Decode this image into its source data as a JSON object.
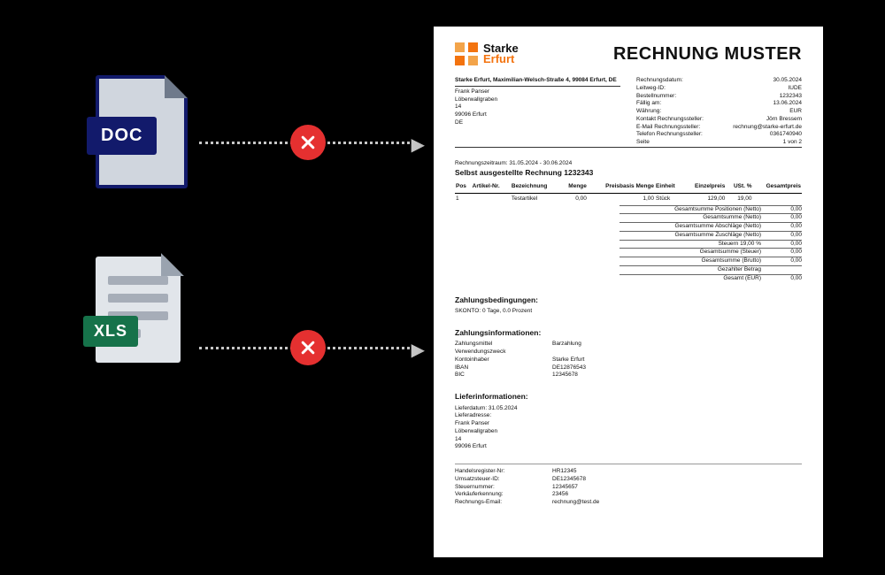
{
  "file_icons": {
    "doc_label": "DOC",
    "xls_label": "XLS"
  },
  "icons": {
    "reject": "reject-icon",
    "arrow": "arrow-right-icon"
  },
  "invoice": {
    "brand_l1": "Starke",
    "brand_l2": "Erfurt",
    "title": "RECHNUNG MUSTER",
    "sender_line": "Starke Erfurt, Maximilian-Welsch-Straße 4, 99084 Erfurt, DE",
    "recipient": {
      "name": "Frank Panser",
      "street": "Löberwallgraben",
      "no": "14",
      "zip_city": "99096 Erfurt",
      "country": "DE"
    },
    "meta_labels": {
      "date": "Rechnungsdatum:",
      "leitweg": "Leitweg-ID:",
      "bestell": "Bestellnummer:",
      "faellig": "Fällig am:",
      "waehrung": "Währung:",
      "kontakt": "Kontakt Rechnungssteller:",
      "email": "E-Mail Rechnungssteller:",
      "tel": "Telefon Rechnungssteller:",
      "seite": "Seite"
    },
    "meta_values": {
      "date": "30.05.2024",
      "leitweg": "IUDE",
      "bestell": "1232343",
      "faellig": "13.06.2024",
      "waehrung": "EUR",
      "kontakt": "Jörn Bressem",
      "email": "rechnung@starke-erfurt.de",
      "tel": "0361740940",
      "seite": "1 von 2"
    },
    "period_label": "Rechnungszeitraum: 31.05.2024 - 30.06.2024",
    "heading": "Selbst ausgestellte Rechnung 1232343",
    "cols": {
      "pos": "Pos",
      "art": "Artikel-Nr.",
      "bez": "Bezeichnung",
      "menge": "Menge",
      "pbasis": "Preisbasis Menge",
      "einheit": "Einheit",
      "einzel": "Einzelpreis",
      "ust": "USt. %",
      "gesamt": "Gesamtpreis"
    },
    "row": {
      "pos": "1",
      "art": "",
      "bez": "Testartikel",
      "menge": "0,00",
      "pbasis": "1,00",
      "einheit": "Stück",
      "einzel": "129,00",
      "ust": "19,00",
      "gesamt": ""
    },
    "sums": [
      {
        "l": "Gesamtsumme Positionen (Netto)",
        "v": "0,00"
      },
      {
        "l": "Gesamtsumme (Netto)",
        "v": "0,00"
      },
      {
        "l": "Gesamtsumme Abschläge (Netto)",
        "v": "0,00"
      },
      {
        "l": "Gesamtsumme Zuschläge (Netto)",
        "v": "0,00"
      },
      {
        "l": "Steuern 19,00 %",
        "v": "0,00"
      },
      {
        "l": "Gesamtsumme (Steuer)",
        "v": "0,00"
      },
      {
        "l": "Gesamtsumme (Brutto)",
        "v": "0,00"
      },
      {
        "l": "Gezahlter Betrag",
        "v": ""
      },
      {
        "l": "Gesamt (EUR)",
        "v": "0,00"
      }
    ],
    "pay_terms_h": "Zahlungsbedingungen:",
    "skonto": "SKONTO: 0 Tage, 0.0 Prozent",
    "pay_info_h": "Zahlungsinformationen:",
    "pay_info": [
      {
        "k": "Zahlungsmittel",
        "v": "Barzahlung"
      },
      {
        "k": "Verwendungszweck",
        "v": ""
      },
      {
        "k": "Kontoinhaber",
        "v": "Starke Erfurt"
      },
      {
        "k": "IBAN",
        "v": "DE12876543"
      },
      {
        "k": "BIC",
        "v": "12345678"
      }
    ],
    "delivery_h": "Lieferinformationen:",
    "delivery": [
      "Lieferdatum: 31.05.2024",
      "Lieferadresse:",
      "Frank Panser",
      "Löberwallgraben",
      "14",
      "99096 Erfurt"
    ],
    "footer": [
      {
        "k": "Handelsregister-Nr:",
        "v": "HR12345"
      },
      {
        "k": "Umsatzsteuer-ID:",
        "v": "DE12345678"
      },
      {
        "k": "Steuernummer:",
        "v": "12345657"
      },
      {
        "k": "Verkäuferkennung:",
        "v": "23456"
      },
      {
        "k": "Rechnungs-Email:",
        "v": "rechnung@test.de"
      }
    ]
  }
}
